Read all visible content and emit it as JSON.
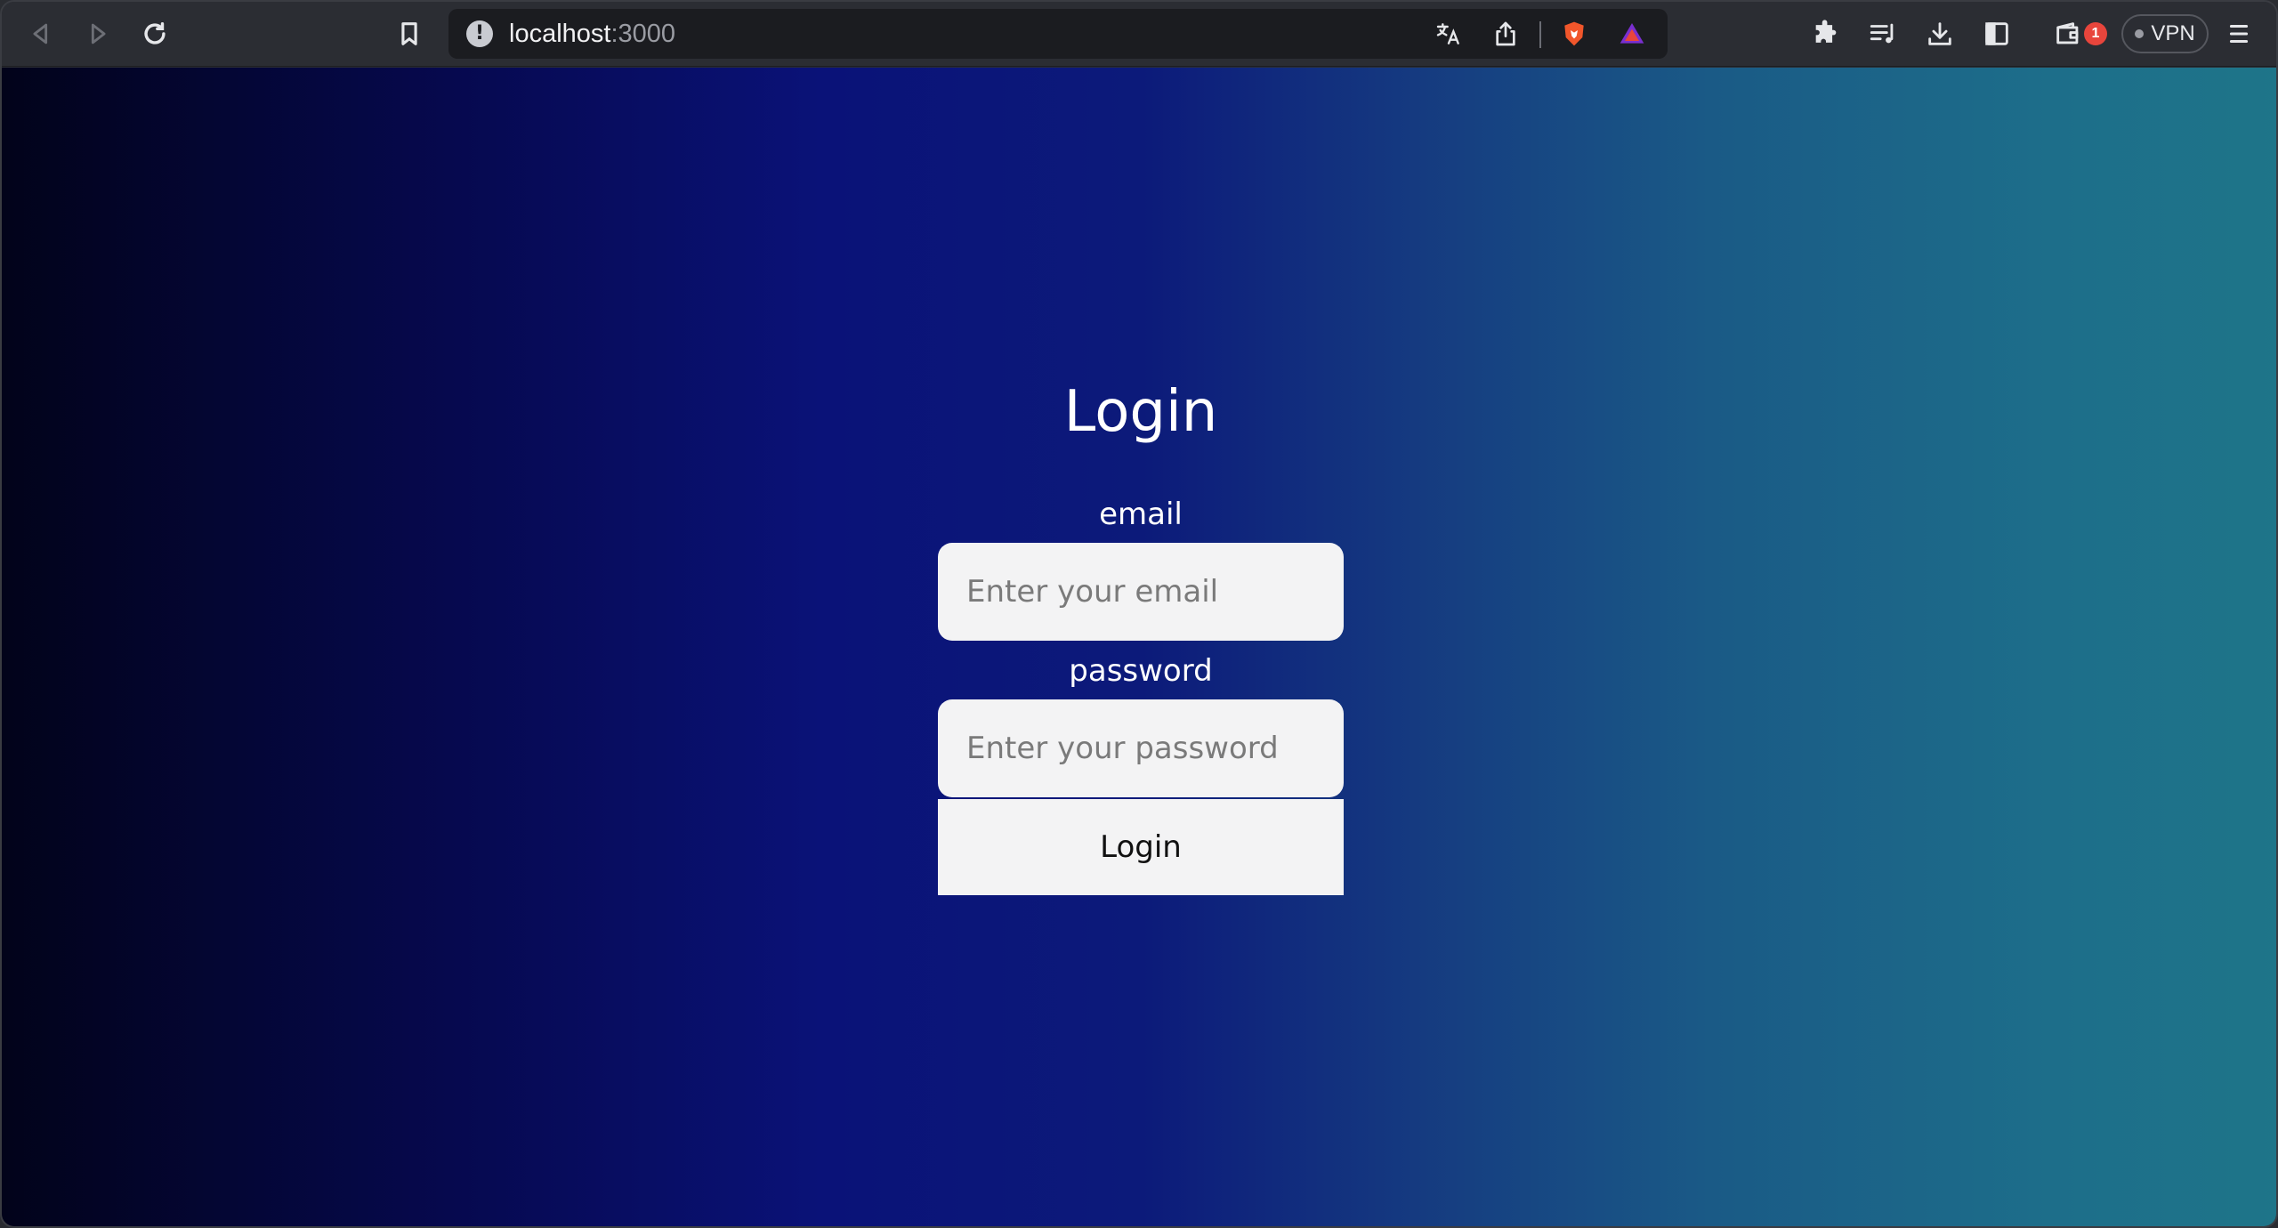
{
  "browser": {
    "url_host": "localhost",
    "url_port": ":3000",
    "notification_count": "1",
    "vpn_label": "VPN",
    "icons": [
      "back-icon",
      "forward-icon",
      "reload-icon",
      "bookmark-icon",
      "site-info-icon",
      "translate-icon",
      "share-icon",
      "brave-shields-icon",
      "brave-rewards-icon",
      "extensions-icon",
      "playlist-icon",
      "downloads-icon",
      "sidebar-icon",
      "wallet-icon",
      "menu-icon"
    ]
  },
  "page": {
    "title": "Login",
    "email_label": "email",
    "email_placeholder": "Enter your email",
    "password_label": "password",
    "password_placeholder": "Enter your password",
    "submit_label": "Login"
  },
  "colors": {
    "gradient_start": "#02031a",
    "gradient_mid": "#0a1278",
    "gradient_end": "#1e7589",
    "input_bg": "#f3f3f4"
  }
}
